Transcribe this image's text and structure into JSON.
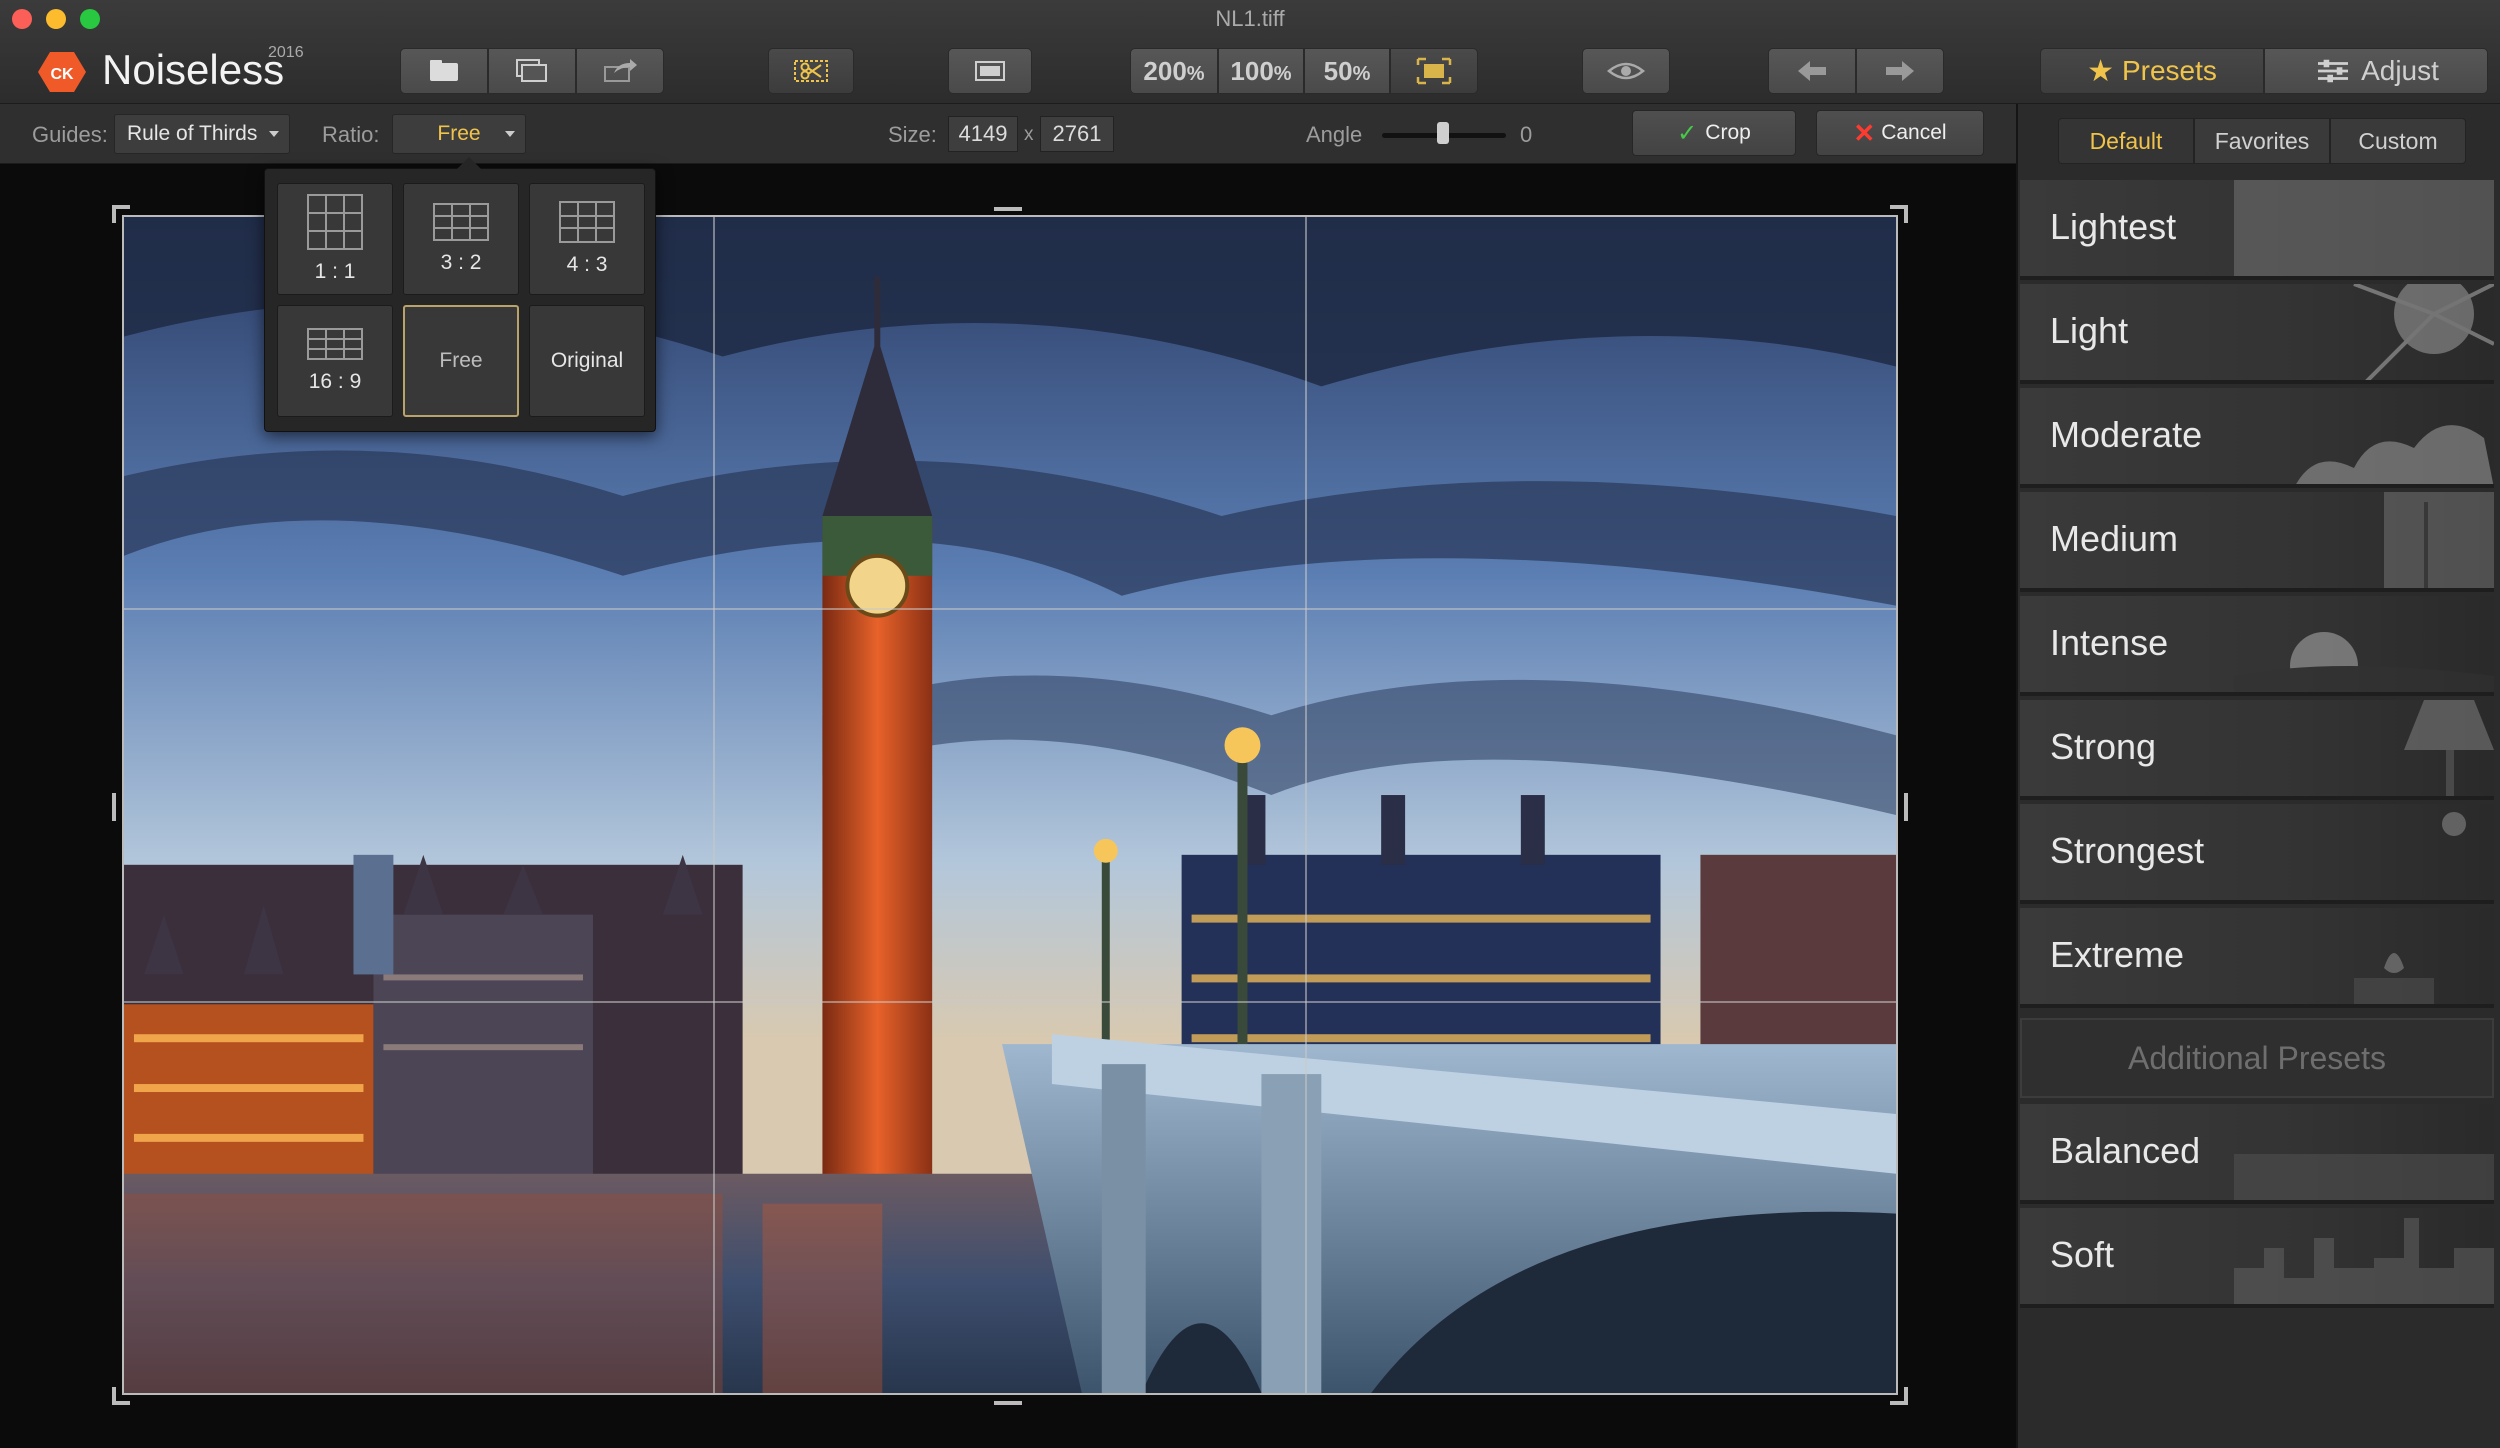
{
  "window": {
    "title": "NL1.tiff"
  },
  "app": {
    "name": "Noiseless",
    "year": "2016",
    "badge": "CK"
  },
  "toolbar": {
    "zoom_200": "200",
    "zoom_100": "100",
    "zoom_50": "50",
    "zoom_unit": "%",
    "tabs": {
      "presets": "Presets",
      "adjust": "Adjust"
    }
  },
  "crop": {
    "guides_label": "Guides:",
    "guides_value": "Rule of Thirds",
    "ratio_label": "Ratio:",
    "ratio_value": "Free",
    "size_label": "Size:",
    "width": "4149",
    "size_sep": "x",
    "height": "2761",
    "angle_label": "Angle",
    "angle_value": "0",
    "crop_button": "Crop",
    "cancel_button": "Cancel"
  },
  "ratio_options": [
    {
      "label": "1 : 1"
    },
    {
      "label": "3 : 2"
    },
    {
      "label": "4 : 3"
    },
    {
      "label": "16 : 9"
    },
    {
      "label": "Free"
    },
    {
      "label": "Original"
    }
  ],
  "sidebar": {
    "subtabs": [
      "Default",
      "Favorites",
      "Custom"
    ],
    "presets": [
      "Lightest",
      "Light",
      "Moderate",
      "Medium",
      "Intense",
      "Strong",
      "Strongest",
      "Extreme"
    ],
    "additional_label": "Additional Presets",
    "additional": [
      "Balanced",
      "Soft"
    ]
  },
  "colors": {
    "accent": "#f0c44b",
    "logo": "#f05a28",
    "check": "#47c94a",
    "cancel": "#ff3b30"
  }
}
